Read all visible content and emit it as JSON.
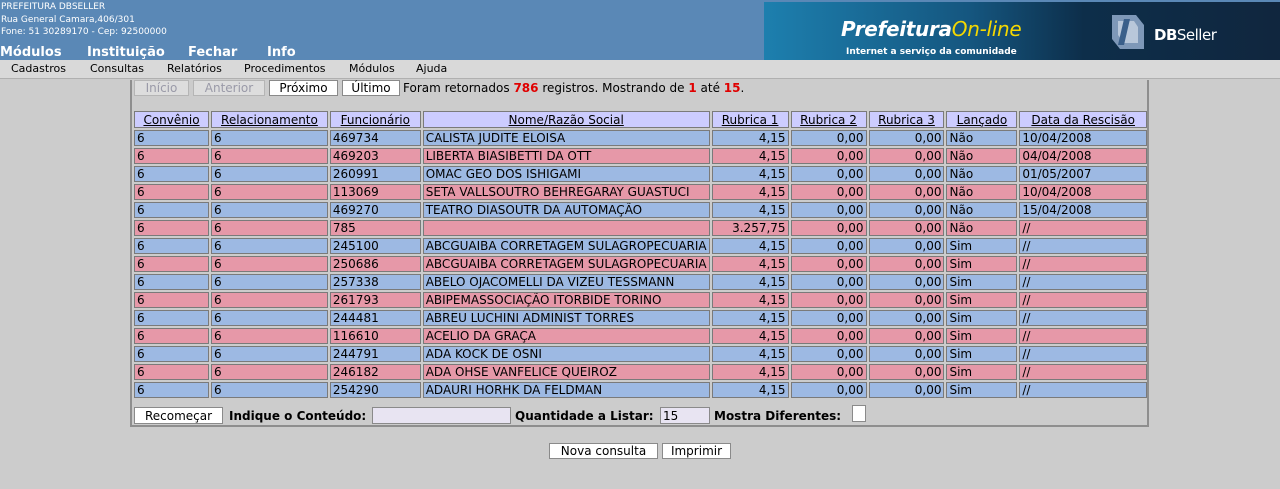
{
  "header": {
    "org_name": "PREFEITURA DBSELLER",
    "address": "Rua General Camara,406/301",
    "phone_line": "Fone: 51 30289170  -  Cep: 92500000",
    "menu": [
      "Módulos",
      "Instituição",
      "Fechar",
      "Info"
    ],
    "banner": {
      "brand_main": "Prefeitura",
      "brand_accent": "On-line",
      "tagline": "Internet a serviço da comunidade",
      "vendor_bold": "DB",
      "vendor_light": "Seller"
    }
  },
  "menubar": [
    "Cadastros",
    "Consultas",
    "Relatórios",
    "Procedimentos",
    "Módulos",
    "Ajuda"
  ],
  "navigation": {
    "first": "Início",
    "previous": "Anterior",
    "next": "Próximo",
    "last": "Último"
  },
  "summary": {
    "prefix": "Foram retornados",
    "total": "786",
    "middle1": "registros. Mostrando de",
    "from": "1",
    "middle2": "até",
    "to": "15",
    "suffix": "."
  },
  "table": {
    "columns": [
      "Convênio",
      "Relacionamento",
      "Funcionário",
      "Nome/Razão Social",
      "Rubrica 1",
      "Rubrica 2",
      "Rubrica 3",
      "Lançado",
      "Data da Rescisão"
    ],
    "rows": [
      [
        "6",
        "6",
        "469734",
        "CALISTA JUDITE ELOISA",
        "4,15",
        "0,00",
        "0,00",
        "Não",
        "10/04/2008"
      ],
      [
        "6",
        "6",
        "469203",
        "LIBERTA BIASIBETTI DA OTT",
        "4,15",
        "0,00",
        "0,00",
        "Não",
        "04/04/2008"
      ],
      [
        "6",
        "6",
        "260991",
        "OMAC GEO DOS ISHIGAMI",
        "4,15",
        "0,00",
        "0,00",
        "Não",
        "01/05/2007"
      ],
      [
        "6",
        "6",
        "113069",
        "SETA VALLSOUTRO BEHREGARAY GUASTUCI",
        "4,15",
        "0,00",
        "0,00",
        "Não",
        "10/04/2008"
      ],
      [
        "6",
        "6",
        "469270",
        "TEATRO DIASOUTR DA AUTOMAÇÃO",
        "4,15",
        "0,00",
        "0,00",
        "Não",
        "15/04/2008"
      ],
      [
        "6",
        "6",
        "785",
        "",
        "3.257,75",
        "0,00",
        "0,00",
        "Não",
        "//"
      ],
      [
        "6",
        "6",
        "245100",
        "ABCGUAIBA CORRETAGEM SULAGROPECUARIA",
        "4,15",
        "0,00",
        "0,00",
        "Sim",
        "//"
      ],
      [
        "6",
        "6",
        "250686",
        "ABCGUAIBA CORRETAGEM SULAGROPECUARIA",
        "4,15",
        "0,00",
        "0,00",
        "Sim",
        "//"
      ],
      [
        "6",
        "6",
        "257338",
        "ABELO OJACOMELLI DA VIZEU TESSMANN",
        "4,15",
        "0,00",
        "0,00",
        "Sim",
        "//"
      ],
      [
        "6",
        "6",
        "261793",
        "ABIPEMASSOCIAÇÃO ITORBIDE TORINO",
        "4,15",
        "0,00",
        "0,00",
        "Sim",
        "//"
      ],
      [
        "6",
        "6",
        "244481",
        "ABREU LUCHINI ADMINIST TORRES",
        "4,15",
        "0,00",
        "0,00",
        "Sim",
        "//"
      ],
      [
        "6",
        "6",
        "116610",
        "ACELIO DA GRAÇA",
        "4,15",
        "0,00",
        "0,00",
        "Sim",
        "//"
      ],
      [
        "6",
        "6",
        "244791",
        "ADA KOCK DE OSNI",
        "4,15",
        "0,00",
        "0,00",
        "Sim",
        "//"
      ],
      [
        "6",
        "6",
        "246182",
        "ADA OHSE VANFELICE QUEIROZ",
        "4,15",
        "0,00",
        "0,00",
        "Sim",
        "//"
      ],
      [
        "6",
        "6",
        "254290",
        "ADAURI HORHK DA FELDMAN",
        "4,15",
        "0,00",
        "0,00",
        "Sim",
        "//"
      ]
    ]
  },
  "filter": {
    "restart_label": "Recomeçar",
    "content_label": "Indique o Conteúdo:",
    "content_value": "",
    "quantity_label": "Quantidade a Listar:",
    "quantity_value": "15",
    "show_diff_label": "Mostra Diferentes:",
    "show_diff_checked": false
  },
  "actions": {
    "new_query": "Nova consulta",
    "print": "Imprimir"
  },
  "colors": {
    "header_bg": "#5a88b6",
    "row_blue": "#9db9e3",
    "row_pink": "#e698a8",
    "column_header_bg": "#ccccff",
    "highlight_red": "#e00000"
  }
}
